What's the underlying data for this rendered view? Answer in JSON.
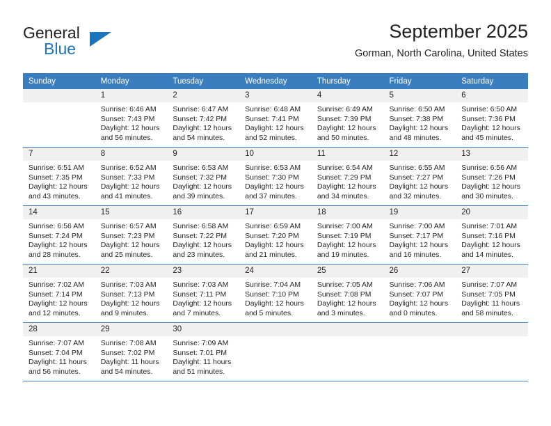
{
  "brand": {
    "word1": "General",
    "word2": "Blue",
    "accent_color": "#1b75bb"
  },
  "header": {
    "title": "September 2025",
    "subtitle": "Gorman, North Carolina, United States"
  },
  "calendar": {
    "header_bg": "#3a7ebf",
    "daynum_bg": "#f0f0f0",
    "weekday_headers": [
      "Sunday",
      "Monday",
      "Tuesday",
      "Wednesday",
      "Thursday",
      "Friday",
      "Saturday"
    ],
    "weeks": [
      [
        {
          "day": "",
          "empty": true,
          "sunrise": "",
          "sunset": "",
          "daylight1": "",
          "daylight2": ""
        },
        {
          "day": "1",
          "empty": false,
          "sunrise": "Sunrise: 6:46 AM",
          "sunset": "Sunset: 7:43 PM",
          "daylight1": "Daylight: 12 hours",
          "daylight2": "and 56 minutes."
        },
        {
          "day": "2",
          "empty": false,
          "sunrise": "Sunrise: 6:47 AM",
          "sunset": "Sunset: 7:42 PM",
          "daylight1": "Daylight: 12 hours",
          "daylight2": "and 54 minutes."
        },
        {
          "day": "3",
          "empty": false,
          "sunrise": "Sunrise: 6:48 AM",
          "sunset": "Sunset: 7:41 PM",
          "daylight1": "Daylight: 12 hours",
          "daylight2": "and 52 minutes."
        },
        {
          "day": "4",
          "empty": false,
          "sunrise": "Sunrise: 6:49 AM",
          "sunset": "Sunset: 7:39 PM",
          "daylight1": "Daylight: 12 hours",
          "daylight2": "and 50 minutes."
        },
        {
          "day": "5",
          "empty": false,
          "sunrise": "Sunrise: 6:50 AM",
          "sunset": "Sunset: 7:38 PM",
          "daylight1": "Daylight: 12 hours",
          "daylight2": "and 48 minutes."
        },
        {
          "day": "6",
          "empty": false,
          "sunrise": "Sunrise: 6:50 AM",
          "sunset": "Sunset: 7:36 PM",
          "daylight1": "Daylight: 12 hours",
          "daylight2": "and 45 minutes."
        }
      ],
      [
        {
          "day": "7",
          "empty": false,
          "sunrise": "Sunrise: 6:51 AM",
          "sunset": "Sunset: 7:35 PM",
          "daylight1": "Daylight: 12 hours",
          "daylight2": "and 43 minutes."
        },
        {
          "day": "8",
          "empty": false,
          "sunrise": "Sunrise: 6:52 AM",
          "sunset": "Sunset: 7:33 PM",
          "daylight1": "Daylight: 12 hours",
          "daylight2": "and 41 minutes."
        },
        {
          "day": "9",
          "empty": false,
          "sunrise": "Sunrise: 6:53 AM",
          "sunset": "Sunset: 7:32 PM",
          "daylight1": "Daylight: 12 hours",
          "daylight2": "and 39 minutes."
        },
        {
          "day": "10",
          "empty": false,
          "sunrise": "Sunrise: 6:53 AM",
          "sunset": "Sunset: 7:30 PM",
          "daylight1": "Daylight: 12 hours",
          "daylight2": "and 37 minutes."
        },
        {
          "day": "11",
          "empty": false,
          "sunrise": "Sunrise: 6:54 AM",
          "sunset": "Sunset: 7:29 PM",
          "daylight1": "Daylight: 12 hours",
          "daylight2": "and 34 minutes."
        },
        {
          "day": "12",
          "empty": false,
          "sunrise": "Sunrise: 6:55 AM",
          "sunset": "Sunset: 7:27 PM",
          "daylight1": "Daylight: 12 hours",
          "daylight2": "and 32 minutes."
        },
        {
          "day": "13",
          "empty": false,
          "sunrise": "Sunrise: 6:56 AM",
          "sunset": "Sunset: 7:26 PM",
          "daylight1": "Daylight: 12 hours",
          "daylight2": "and 30 minutes."
        }
      ],
      [
        {
          "day": "14",
          "empty": false,
          "sunrise": "Sunrise: 6:56 AM",
          "sunset": "Sunset: 7:24 PM",
          "daylight1": "Daylight: 12 hours",
          "daylight2": "and 28 minutes."
        },
        {
          "day": "15",
          "empty": false,
          "sunrise": "Sunrise: 6:57 AM",
          "sunset": "Sunset: 7:23 PM",
          "daylight1": "Daylight: 12 hours",
          "daylight2": "and 25 minutes."
        },
        {
          "day": "16",
          "empty": false,
          "sunrise": "Sunrise: 6:58 AM",
          "sunset": "Sunset: 7:22 PM",
          "daylight1": "Daylight: 12 hours",
          "daylight2": "and 23 minutes."
        },
        {
          "day": "17",
          "empty": false,
          "sunrise": "Sunrise: 6:59 AM",
          "sunset": "Sunset: 7:20 PM",
          "daylight1": "Daylight: 12 hours",
          "daylight2": "and 21 minutes."
        },
        {
          "day": "18",
          "empty": false,
          "sunrise": "Sunrise: 7:00 AM",
          "sunset": "Sunset: 7:19 PM",
          "daylight1": "Daylight: 12 hours",
          "daylight2": "and 19 minutes."
        },
        {
          "day": "19",
          "empty": false,
          "sunrise": "Sunrise: 7:00 AM",
          "sunset": "Sunset: 7:17 PM",
          "daylight1": "Daylight: 12 hours",
          "daylight2": "and 16 minutes."
        },
        {
          "day": "20",
          "empty": false,
          "sunrise": "Sunrise: 7:01 AM",
          "sunset": "Sunset: 7:16 PM",
          "daylight1": "Daylight: 12 hours",
          "daylight2": "and 14 minutes."
        }
      ],
      [
        {
          "day": "21",
          "empty": false,
          "sunrise": "Sunrise: 7:02 AM",
          "sunset": "Sunset: 7:14 PM",
          "daylight1": "Daylight: 12 hours",
          "daylight2": "and 12 minutes."
        },
        {
          "day": "22",
          "empty": false,
          "sunrise": "Sunrise: 7:03 AM",
          "sunset": "Sunset: 7:13 PM",
          "daylight1": "Daylight: 12 hours",
          "daylight2": "and 9 minutes."
        },
        {
          "day": "23",
          "empty": false,
          "sunrise": "Sunrise: 7:03 AM",
          "sunset": "Sunset: 7:11 PM",
          "daylight1": "Daylight: 12 hours",
          "daylight2": "and 7 minutes."
        },
        {
          "day": "24",
          "empty": false,
          "sunrise": "Sunrise: 7:04 AM",
          "sunset": "Sunset: 7:10 PM",
          "daylight1": "Daylight: 12 hours",
          "daylight2": "and 5 minutes."
        },
        {
          "day": "25",
          "empty": false,
          "sunrise": "Sunrise: 7:05 AM",
          "sunset": "Sunset: 7:08 PM",
          "daylight1": "Daylight: 12 hours",
          "daylight2": "and 3 minutes."
        },
        {
          "day": "26",
          "empty": false,
          "sunrise": "Sunrise: 7:06 AM",
          "sunset": "Sunset: 7:07 PM",
          "daylight1": "Daylight: 12 hours",
          "daylight2": "and 0 minutes."
        },
        {
          "day": "27",
          "empty": false,
          "sunrise": "Sunrise: 7:07 AM",
          "sunset": "Sunset: 7:05 PM",
          "daylight1": "Daylight: 11 hours",
          "daylight2": "and 58 minutes."
        }
      ],
      [
        {
          "day": "28",
          "empty": false,
          "sunrise": "Sunrise: 7:07 AM",
          "sunset": "Sunset: 7:04 PM",
          "daylight1": "Daylight: 11 hours",
          "daylight2": "and 56 minutes."
        },
        {
          "day": "29",
          "empty": false,
          "sunrise": "Sunrise: 7:08 AM",
          "sunset": "Sunset: 7:02 PM",
          "daylight1": "Daylight: 11 hours",
          "daylight2": "and 54 minutes."
        },
        {
          "day": "30",
          "empty": false,
          "sunrise": "Sunrise: 7:09 AM",
          "sunset": "Sunset: 7:01 PM",
          "daylight1": "Daylight: 11 hours",
          "daylight2": "and 51 minutes."
        },
        {
          "day": "",
          "empty": true,
          "sunrise": "",
          "sunset": "",
          "daylight1": "",
          "daylight2": ""
        },
        {
          "day": "",
          "empty": true,
          "sunrise": "",
          "sunset": "",
          "daylight1": "",
          "daylight2": ""
        },
        {
          "day": "",
          "empty": true,
          "sunrise": "",
          "sunset": "",
          "daylight1": "",
          "daylight2": ""
        },
        {
          "day": "",
          "empty": true,
          "sunrise": "",
          "sunset": "",
          "daylight1": "",
          "daylight2": ""
        }
      ]
    ]
  }
}
